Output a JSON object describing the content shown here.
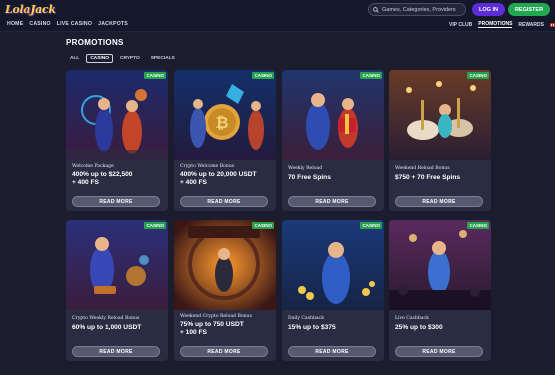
{
  "brand": {
    "logo_part1": "Lola",
    "logo_part2": "Jack"
  },
  "nav": {
    "items": [
      "HOME",
      "CASINO",
      "LIVE CASINO",
      "JACKPOTS"
    ]
  },
  "search": {
    "placeholder": "Games, Categories, Providers"
  },
  "auth": {
    "login_label": "LOG IN",
    "register_label": "REGISTER"
  },
  "subnav": {
    "items": [
      "VIP CLUB",
      "PROMOTIONS",
      "REWARDS"
    ],
    "active": "PROMOTIONS"
  },
  "page": {
    "title": "PROMOTIONS"
  },
  "filters": {
    "items": [
      "ALL",
      "CASINO",
      "CRYPTO",
      "SPECIALS"
    ],
    "active": "CASINO"
  },
  "colors": {
    "accent_login": "#5c2dd6",
    "accent_register": "#21a651",
    "badge_green": "#27a24c",
    "background": "#1b1d2e",
    "card": "#2a2c42"
  },
  "promotions": [
    {
      "badge": "CASINO",
      "subtitle": "Welcome Package",
      "offer_line1": "400% up to $22,500",
      "offer_line2": "+ 400 FS",
      "button": "READ MORE"
    },
    {
      "badge": "CASINO",
      "subtitle": "Crypto Welcome Bonus",
      "offer_line1": "400% up to 20,000 USDT",
      "offer_line2": "+ 400 FS",
      "button": "READ MORE"
    },
    {
      "badge": "CASINO",
      "subtitle": "Weekly Reload",
      "offer_line1": "70 Free Spins",
      "offer_line2": "",
      "button": "READ MORE"
    },
    {
      "badge": "CASINO",
      "subtitle": "Weekend Reload Bonus",
      "offer_line1": "$750 + 70 Free Spins",
      "offer_line2": "",
      "button": "READ MORE"
    },
    {
      "badge": "CASINO",
      "subtitle": "Crypto Weekly Reload Bonus",
      "offer_line1": "60% up to 1,000 USDT",
      "offer_line2": "",
      "button": "READ MORE"
    },
    {
      "badge": "CASINO",
      "subtitle": "Weekend Crypto Reload Bonus",
      "offer_line1": "75% up to 750 USDT",
      "offer_line2": "+ 100 FS",
      "button": "READ MORE"
    },
    {
      "badge": "CASINO",
      "subtitle": "Daily Cashback",
      "offer_line1": "15% up to $375",
      "offer_line2": "",
      "button": "READ MORE"
    },
    {
      "badge": "CASINO",
      "subtitle": "Live Cashback",
      "offer_line1": "25% up to $300",
      "offer_line2": "",
      "button": "READ MORE"
    }
  ],
  "icons": [
    "search-icon",
    "uk-flag-icon"
  ]
}
